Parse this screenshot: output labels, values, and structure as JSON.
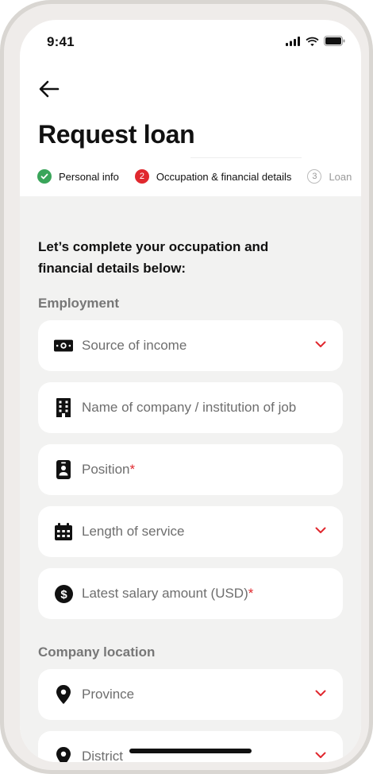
{
  "status_bar": {
    "time": "9:41"
  },
  "header": {
    "title": "Request loan"
  },
  "steps": [
    {
      "number": "",
      "label": "Personal info",
      "state": "done"
    },
    {
      "number": "2",
      "label": "Occupation & financial details",
      "state": "active"
    },
    {
      "number": "3",
      "label": "Loan",
      "state": "pending"
    }
  ],
  "intro": "Let’s complete your occupation and financial details below:",
  "sections": {
    "employment": "Employment",
    "company_location": "Company location"
  },
  "fields": {
    "source_of_income": {
      "placeholder": "Source of income",
      "icon": "cash-icon"
    },
    "company_name": {
      "placeholder": "Name of company / institution of job",
      "icon": "building-icon"
    },
    "position": {
      "placeholder": "Position",
      "required_mark": "*",
      "icon": "badge-icon"
    },
    "length_of_service": {
      "placeholder": "Length of service",
      "icon": "calendar-icon"
    },
    "salary": {
      "placeholder": "Latest salary amount (USD)",
      "required_mark": "*",
      "icon": "dollar-icon"
    },
    "province": {
      "placeholder": "Province",
      "icon": "location-pin-icon"
    },
    "district": {
      "placeholder": "District",
      "icon": "location-pin-icon"
    }
  },
  "colors": {
    "accent": "#e0282e",
    "success": "#3aa55a",
    "background": "#f2f2f1",
    "field": "#ffffff"
  }
}
